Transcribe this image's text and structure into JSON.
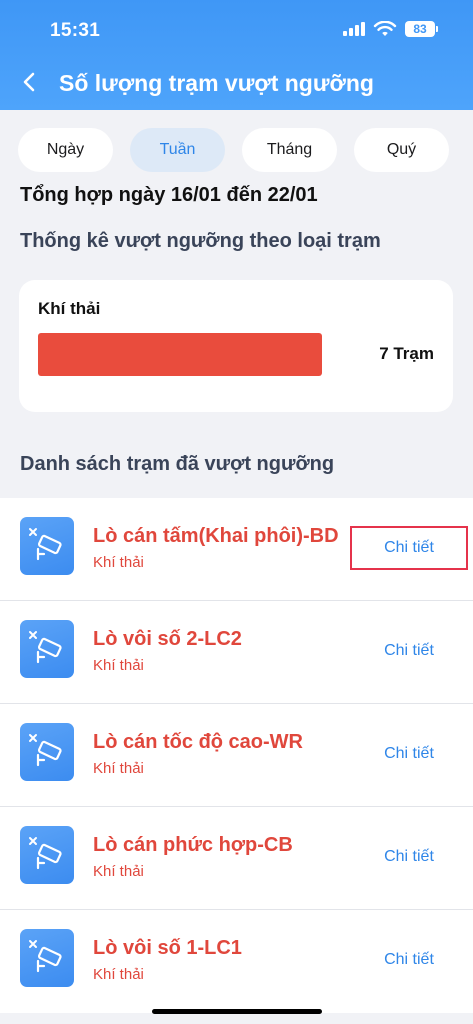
{
  "status_bar": {
    "time": "15:31",
    "battery": "83"
  },
  "nav": {
    "title": "Số lượng trạm vượt ngưỡng"
  },
  "tabs": [
    {
      "label": "Ngày",
      "active": false
    },
    {
      "label": "Tuần",
      "active": true
    },
    {
      "label": "Tháng",
      "active": false
    },
    {
      "label": "Quý",
      "active": false
    }
  ],
  "summary_title": "Tổng hợp ngày 16/01 đến 22/01",
  "stats_section": {
    "title": "Thống kê vượt ngưỡng theo loại trạm",
    "category": "Khí thải",
    "value": "7 Trạm",
    "fill_fraction": 1.0,
    "bar_color": "#e94c3d"
  },
  "list": {
    "title": "Danh sách trạm đã vượt ngưỡng",
    "detail_label": "Chi tiết",
    "items": [
      {
        "name": "Lò cán tấm(Khai phôi)-BD",
        "type": "Khí thải"
      },
      {
        "name": "Lò vôi số 2-LC2",
        "type": "Khí thải"
      },
      {
        "name": "Lò cán tốc độ cao-WR",
        "type": "Khí thải"
      },
      {
        "name": "Lò cán phức hợp-CB",
        "type": "Khí thải"
      },
      {
        "name": "Lò vôi số 1-LC1",
        "type": "Khí thải"
      }
    ]
  },
  "colors": {
    "accent": "#3f97f6",
    "alert": "#e0473c",
    "link": "#2f86e8"
  },
  "icons": {
    "back": "chevron-left-icon",
    "station": "camera-offline-icon"
  }
}
